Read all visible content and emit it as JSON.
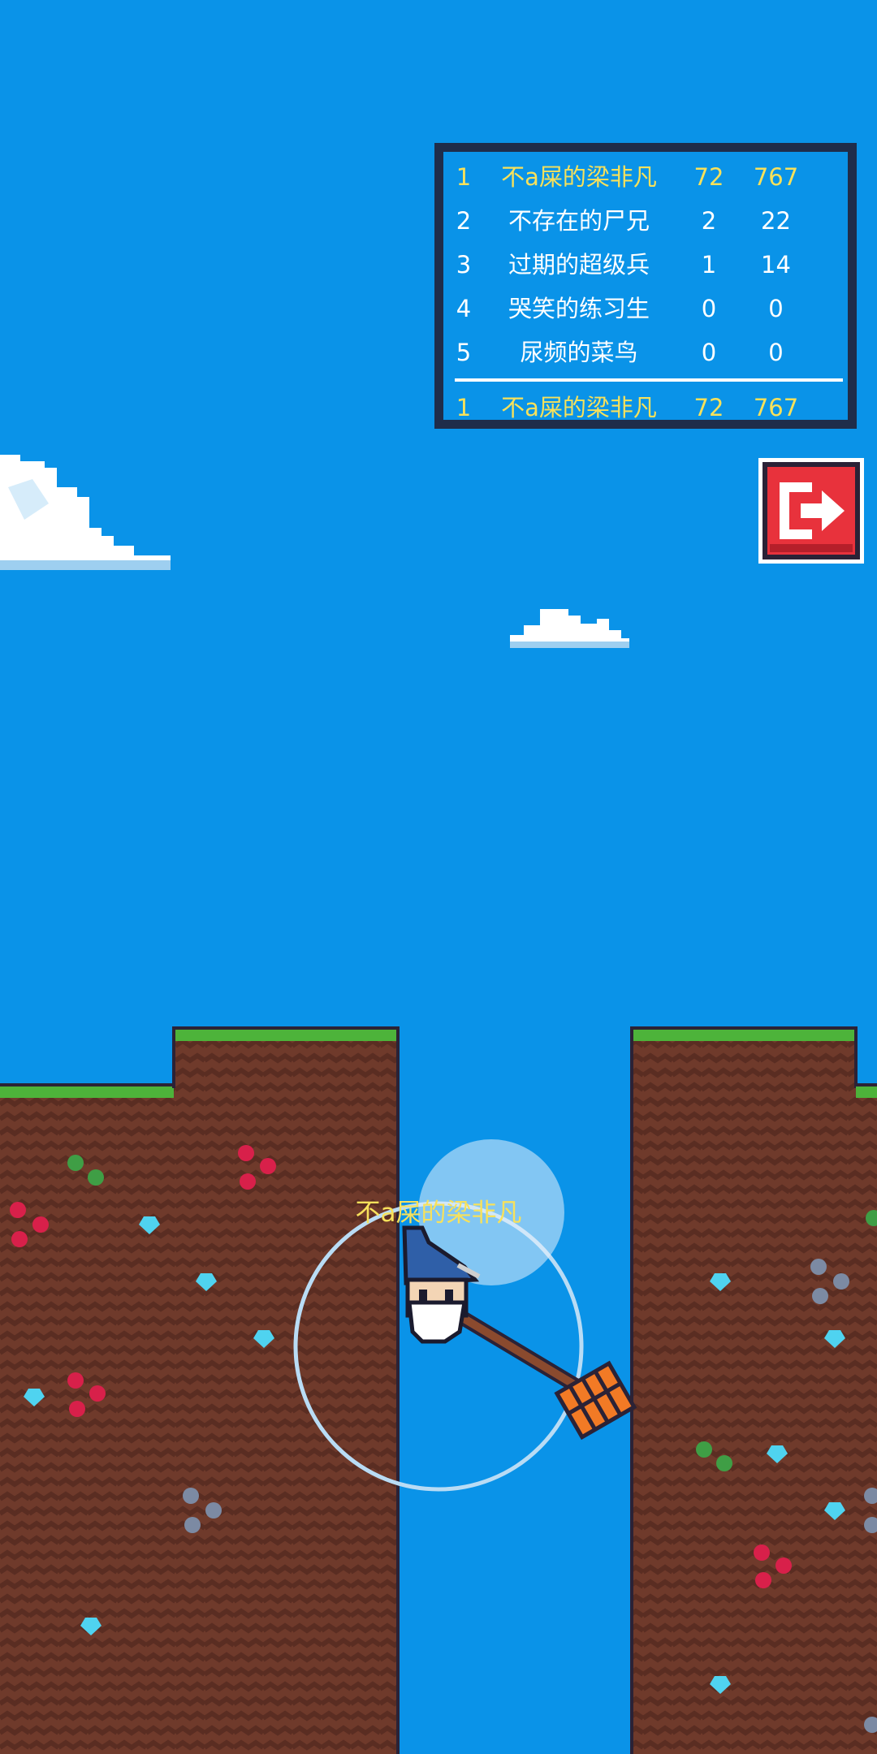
{
  "leaderboard": {
    "rows": [
      {
        "rank": "1",
        "name": "不a屎的梁非凡",
        "depth": "72",
        "score": "767",
        "highlight": true
      },
      {
        "rank": "2",
        "name": "不存在的尸兄",
        "depth": "2",
        "score": "22"
      },
      {
        "rank": "3",
        "name": "过期的超级兵",
        "depth": "1",
        "score": "14"
      },
      {
        "rank": "4",
        "name": "哭笑的练习生",
        "depth": "0",
        "score": "0"
      },
      {
        "rank": "5",
        "name": "尿频的菜鸟",
        "depth": "0",
        "score": "0"
      }
    ],
    "self": {
      "rank": "1",
      "name": "不a屎的梁非凡",
      "depth": "72",
      "score": "767"
    }
  },
  "player": {
    "name": "不a屎的梁非凡"
  },
  "icons": {
    "exit": "exit-door-arrow-icon",
    "hammer": "hammer-icon",
    "character": "wizard-character"
  },
  "colors": {
    "sky": "#0a93e8",
    "dirt": "#6e3a2c",
    "grass": "#4db33a",
    "highlight": "#f7e15b",
    "exit_red": "#e8323c"
  }
}
